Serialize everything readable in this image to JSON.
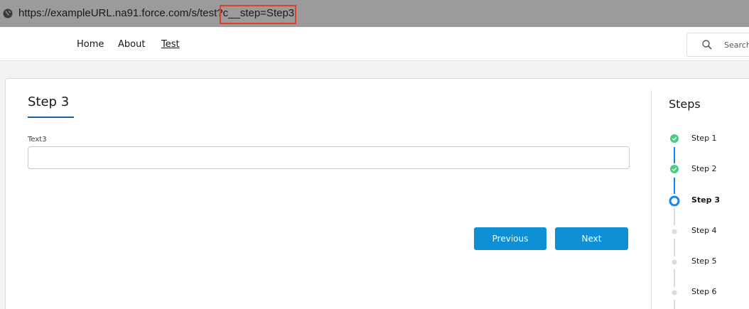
{
  "browser": {
    "url_prefix": "https://exampleURL.na91.force.com/s/test?",
    "url_param": "c__step=Step3"
  },
  "nav": {
    "home": "Home",
    "about": "About",
    "test": "Test"
  },
  "search": {
    "placeholder": "Search"
  },
  "main": {
    "step_title": "Step 3",
    "field_label": "Text3",
    "field_value": "",
    "previous_label": "Previous",
    "next_label": "Next"
  },
  "steps_panel": {
    "title": "Steps",
    "items": [
      {
        "label": "Step 1",
        "status": "complete"
      },
      {
        "label": "Step 2",
        "status": "complete"
      },
      {
        "label": "Step 3",
        "status": "current"
      },
      {
        "label": "Step 4",
        "status": "incomplete"
      },
      {
        "label": "Step 5",
        "status": "incomplete"
      },
      {
        "label": "Step 6",
        "status": "incomplete"
      }
    ]
  },
  "colors": {
    "brand_blue": "#0e8fd6",
    "complete_green": "#4bca81",
    "current_blue": "#1589ee",
    "incomplete_gray": "#dddbda",
    "highlight_red": "#e0402a"
  }
}
